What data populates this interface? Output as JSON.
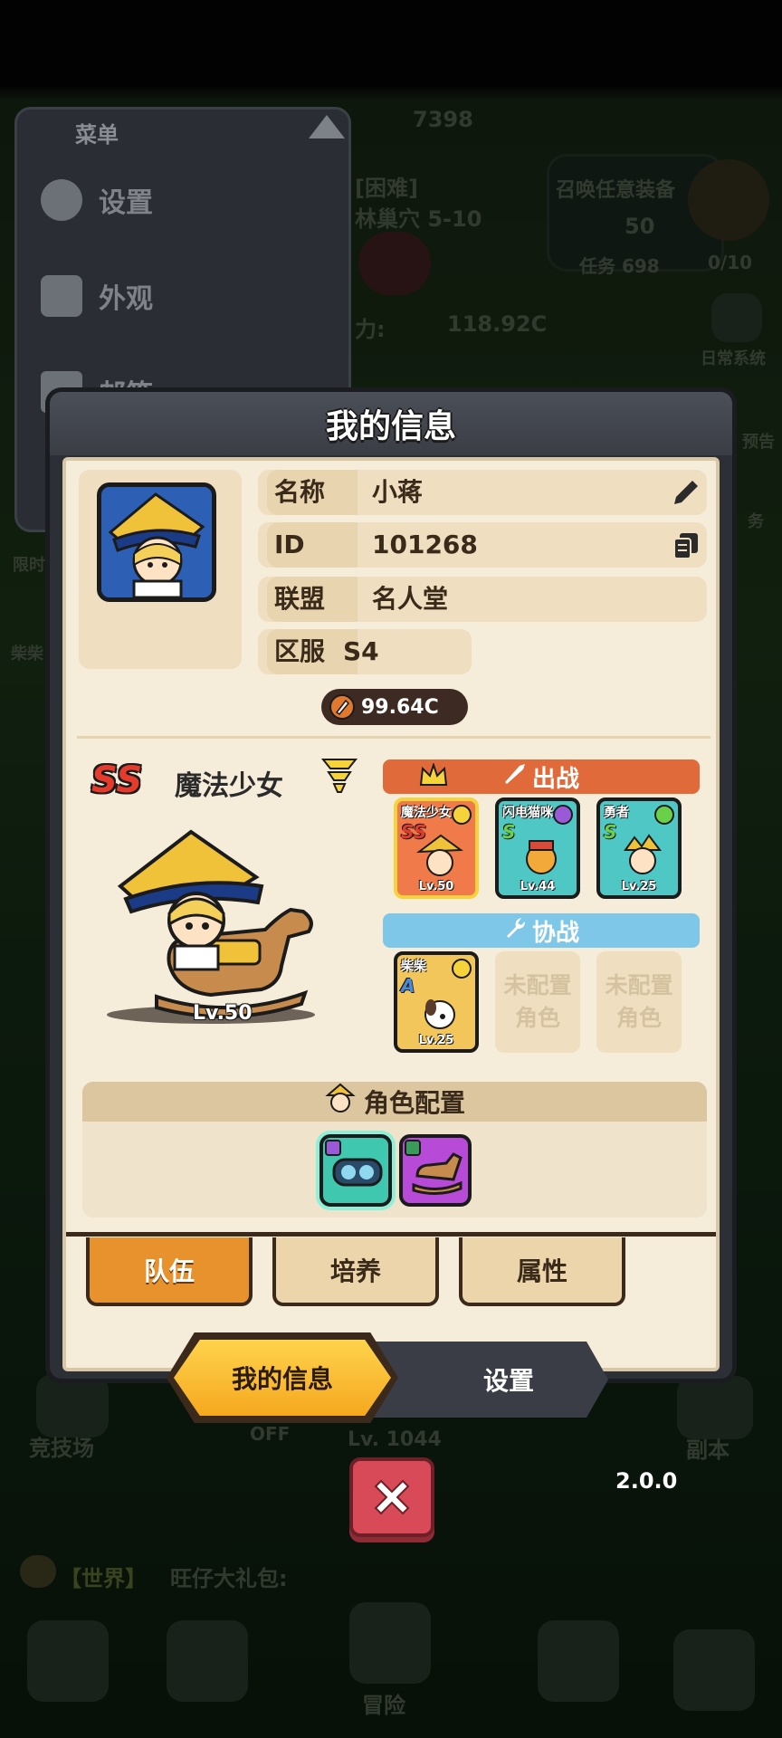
{
  "background": {
    "top_counter": "7398",
    "stage_line1": "[困难]",
    "stage_line2": "林巢穴 5-10",
    "power_label": "力:",
    "power_value": "118.92C",
    "summon_title": "召唤任意装备",
    "summon_cost": "50",
    "summon_task": "任务 698",
    "summon_progress": "0/10",
    "daily_system": "日常系统",
    "side_notice": "预告",
    "side_task": "务",
    "limited": "限时",
    "chaichai": "柴柴",
    "arena": "竞技场",
    "dungeon": "副本",
    "off_label": "OFF",
    "bg_level": "Lv. 1044",
    "chat_channel": "【世界】",
    "chat_text": "旺仔大礼包:",
    "adventure": "冒险"
  },
  "side_menu": {
    "title": "菜单",
    "items": [
      {
        "label": "设置",
        "icon": "gear-icon"
      },
      {
        "label": "外观",
        "icon": "shirt-icon"
      },
      {
        "label": "邮箱",
        "icon": "mail-icon"
      }
    ]
  },
  "dialog": {
    "title": "我的信息",
    "profile": {
      "name_label": "名称",
      "name_value": "小蒋",
      "id_label": "ID",
      "id_value": "101268",
      "alliance_label": "联盟",
      "alliance_value": "名人堂",
      "server_label": "区服",
      "server_value": "S4",
      "power": "99.64C"
    },
    "hero": {
      "grade": "SS",
      "name": "魔法少女",
      "level": "Lv.50"
    },
    "battle": {
      "label": "出战",
      "cards": [
        {
          "name": "魔法少女",
          "grade": "SS",
          "level": "Lv.50",
          "color": "#f07a4a"
        },
        {
          "name": "闪电猫咪",
          "grade": "S",
          "level": "Lv.44",
          "color": "#4fc7c4"
        },
        {
          "name": "勇者",
          "grade": "S",
          "level": "Lv.25",
          "color": "#4fc7c4"
        }
      ]
    },
    "assist": {
      "label": "协战",
      "cards": [
        {
          "name": "柴柴",
          "grade": "A",
          "level": "Lv.25",
          "color": "#f2c65a"
        }
      ],
      "empty_line1": "未配置",
      "empty_line2": "角色"
    },
    "role_config": {
      "title": "角色配置"
    },
    "sub_tabs": [
      "队伍",
      "培养",
      "属性"
    ],
    "main_tabs": [
      "我的信息",
      "设置"
    ]
  },
  "version": "2.0.0",
  "colors": {
    "accent_orange": "#e8922e",
    "battle_banner": "#e06a3a",
    "assist_banner": "#7ec7e8",
    "close_red": "#d94a58"
  }
}
